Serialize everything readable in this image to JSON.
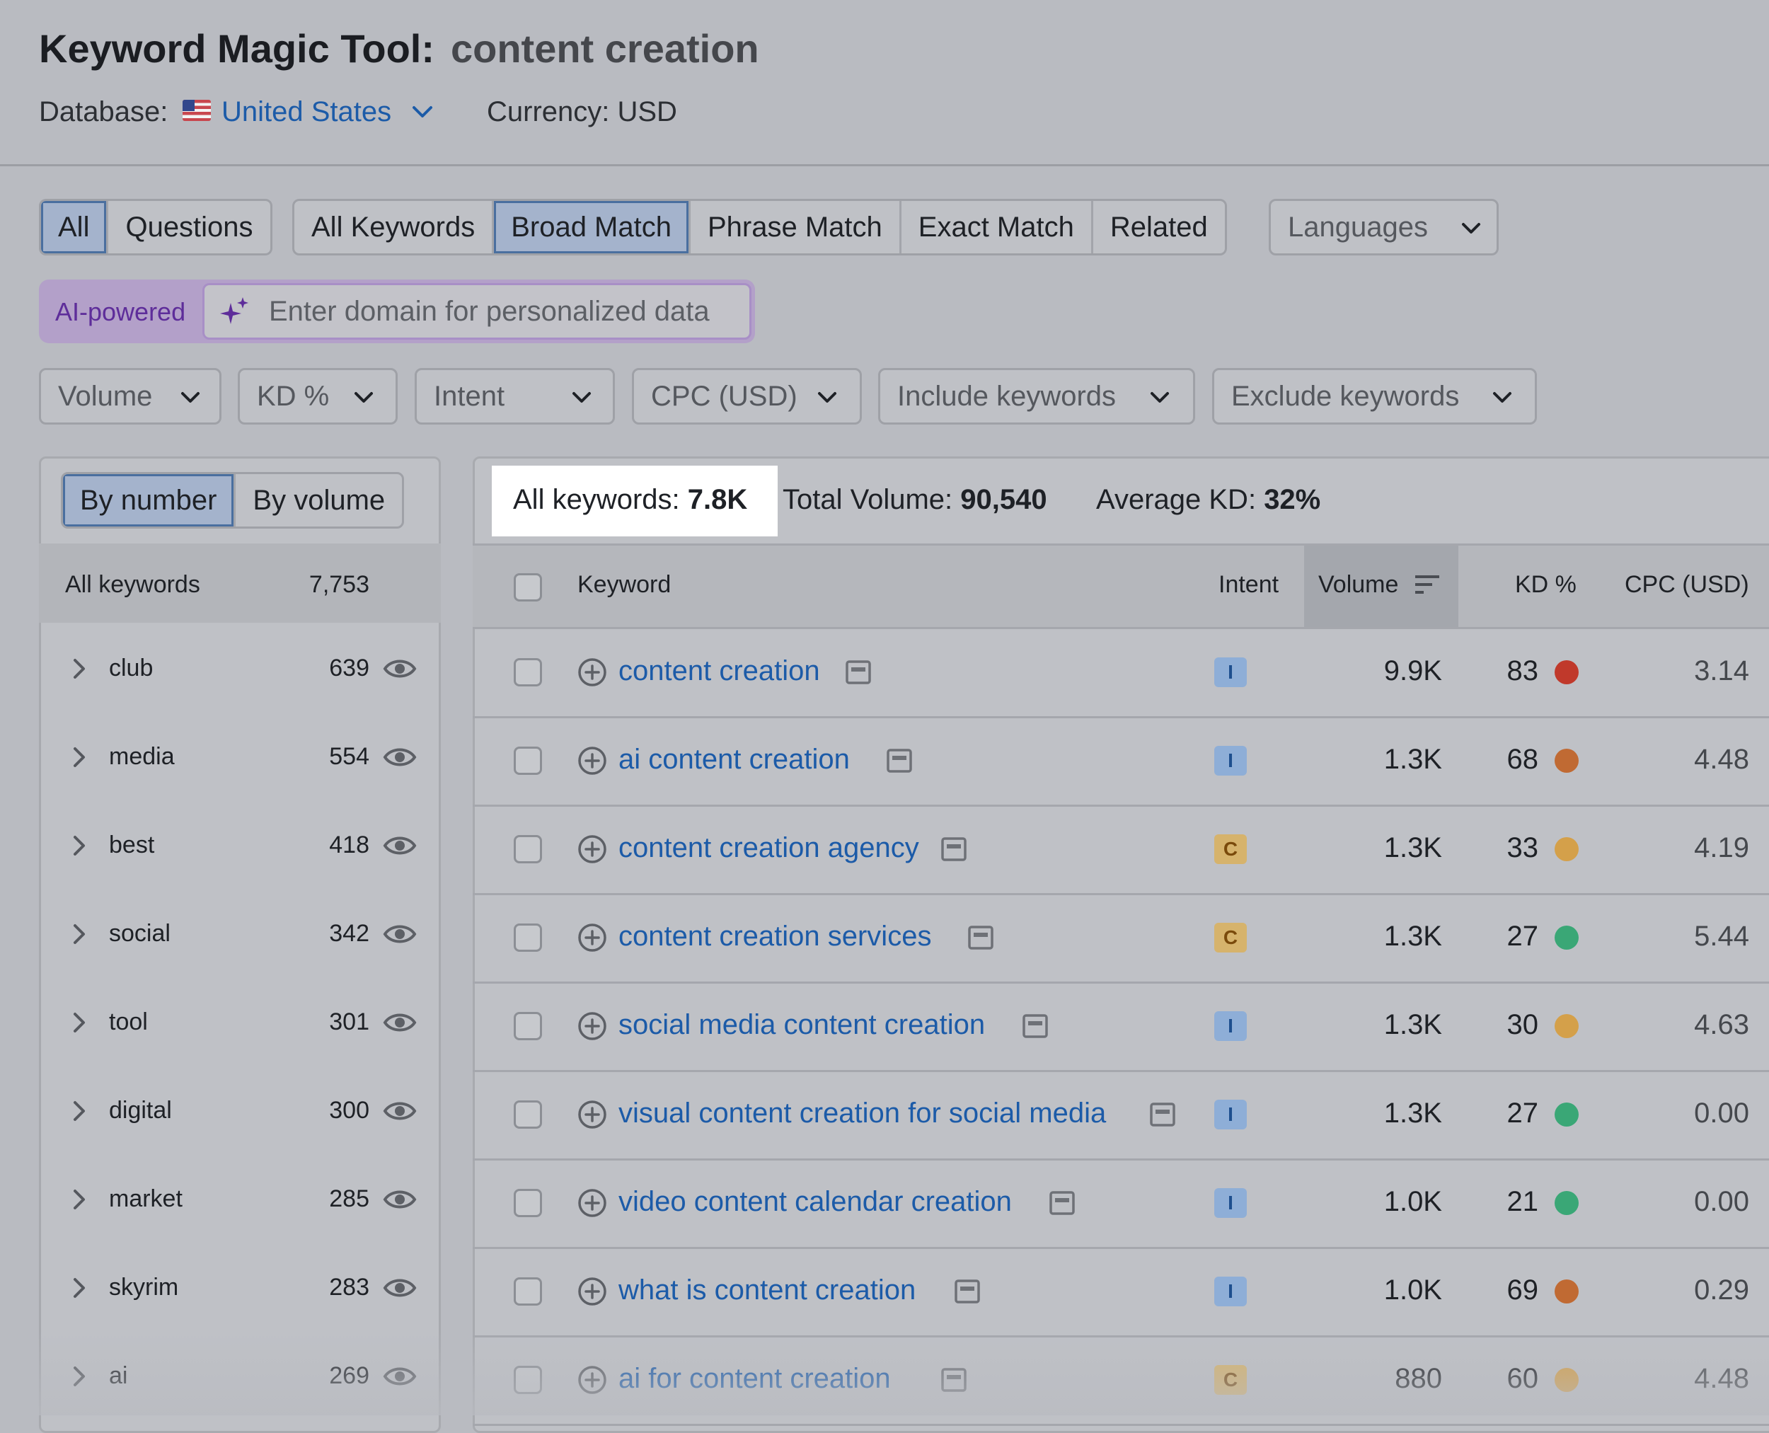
{
  "header": {
    "tool_title": "Keyword Magic Tool:",
    "query": "content creation",
    "database_label": "Database:",
    "database_value": "United States",
    "currency": "Currency: USD"
  },
  "tabs": {
    "group1": [
      "All",
      "Questions"
    ],
    "group2": [
      "All Keywords",
      "Broad Match",
      "Phrase Match",
      "Exact Match",
      "Related"
    ],
    "languages": "Languages"
  },
  "ai": {
    "label": "AI-powered",
    "placeholder": "Enter domain for personalized data"
  },
  "filters": [
    "Volume",
    "KD %",
    "Intent",
    "CPC (USD)",
    "Include keywords",
    "Exclude keywords"
  ],
  "sidebar": {
    "toggle": [
      "By number",
      "By volume"
    ],
    "all_label": "All keywords",
    "all_count": "7,753",
    "items": [
      {
        "label": "club",
        "count": "639"
      },
      {
        "label": "media",
        "count": "554"
      },
      {
        "label": "best",
        "count": "418"
      },
      {
        "label": "social",
        "count": "342"
      },
      {
        "label": "tool",
        "count": "301"
      },
      {
        "label": "digital",
        "count": "300"
      },
      {
        "label": "market",
        "count": "285"
      },
      {
        "label": "skyrim",
        "count": "283"
      },
      {
        "label": "ai",
        "count": "269"
      }
    ]
  },
  "stats": {
    "all_label": "All keywords:",
    "all_value": "7.8K",
    "volume_label": "Total Volume:",
    "volume_value": "90,540",
    "kd_label": "Average KD:",
    "kd_value": "32%"
  },
  "table": {
    "headers": {
      "keyword": "Keyword",
      "intent": "Intent",
      "volume": "Volume",
      "kd": "KD %",
      "cpc": "CPC (USD)"
    },
    "rows": [
      {
        "keyword": "content creation",
        "intent": "I",
        "volume": "9.9K",
        "kd": "83",
        "kd_color": "#c0392b",
        "cpc": "3.14"
      },
      {
        "keyword": "ai content creation",
        "intent": "I",
        "volume": "1.3K",
        "kd": "68",
        "kd_color": "#c06a33",
        "cpc": "4.48"
      },
      {
        "keyword": "content creation agency",
        "intent": "C",
        "volume": "1.3K",
        "kd": "33",
        "kd_color": "#d4a04a",
        "cpc": "4.19"
      },
      {
        "keyword": "content creation services",
        "intent": "C",
        "volume": "1.3K",
        "kd": "27",
        "kd_color": "#3aa776",
        "cpc": "5.44"
      },
      {
        "keyword": "social media content creation",
        "intent": "I",
        "volume": "1.3K",
        "kd": "30",
        "kd_color": "#d4a04a",
        "cpc": "4.63"
      },
      {
        "keyword": "visual content creation for social media",
        "intent": "I",
        "volume": "1.3K",
        "kd": "27",
        "kd_color": "#3aa776",
        "cpc": "0.00"
      },
      {
        "keyword": "video content calendar creation",
        "intent": "I",
        "volume": "1.0K",
        "kd": "21",
        "kd_color": "#3aa776",
        "cpc": "0.00"
      },
      {
        "keyword": "what is content creation",
        "intent": "I",
        "volume": "1.0K",
        "kd": "69",
        "kd_color": "#c06a33",
        "cpc": "0.29"
      },
      {
        "keyword": "ai for content creation",
        "intent": "C",
        "volume": "880",
        "kd": "60",
        "kd_color": "#d4a04a",
        "cpc": "4.48"
      }
    ]
  },
  "colors": {
    "accent": "#1c5ba8",
    "ai_purple": "#5e2d9a",
    "background": "#b9bbc1"
  }
}
